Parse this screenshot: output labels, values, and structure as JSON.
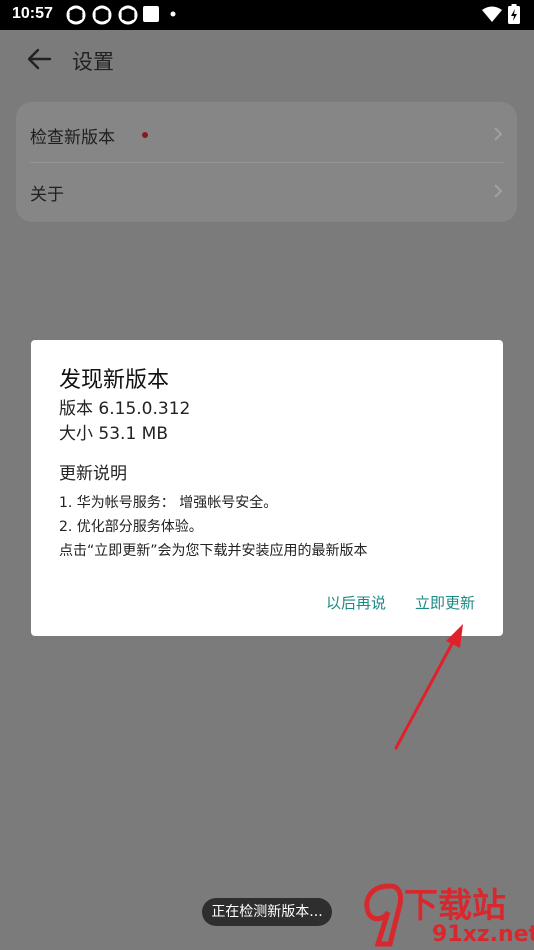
{
  "status_bar": {
    "time": "10:57"
  },
  "app_bar": {
    "title": "设置"
  },
  "settings": {
    "items": [
      {
        "label": "检查新版本",
        "has_badge": true
      },
      {
        "label": "关于",
        "has_badge": false
      }
    ]
  },
  "dialog": {
    "title": "发现新版本",
    "version_line": "版本  6.15.0.312",
    "size_line": "大小  53.1 MB",
    "changelog_title": "更新说明",
    "notes": [
      "1. 华为帐号服务： 增强帐号安全。",
      "2. 优化部分服务体验。",
      "点击“立即更新”会为您下载并安装应用的最新版本"
    ],
    "later_label": "以后再说",
    "update_label": "立即更新"
  },
  "toast": {
    "text": "正在检测新版本..."
  },
  "watermark": {
    "line1": "下载站",
    "line2": "91xz.net"
  },
  "colors": {
    "accent": "#1a8a85",
    "annotation_arrow": "#e0202a"
  }
}
